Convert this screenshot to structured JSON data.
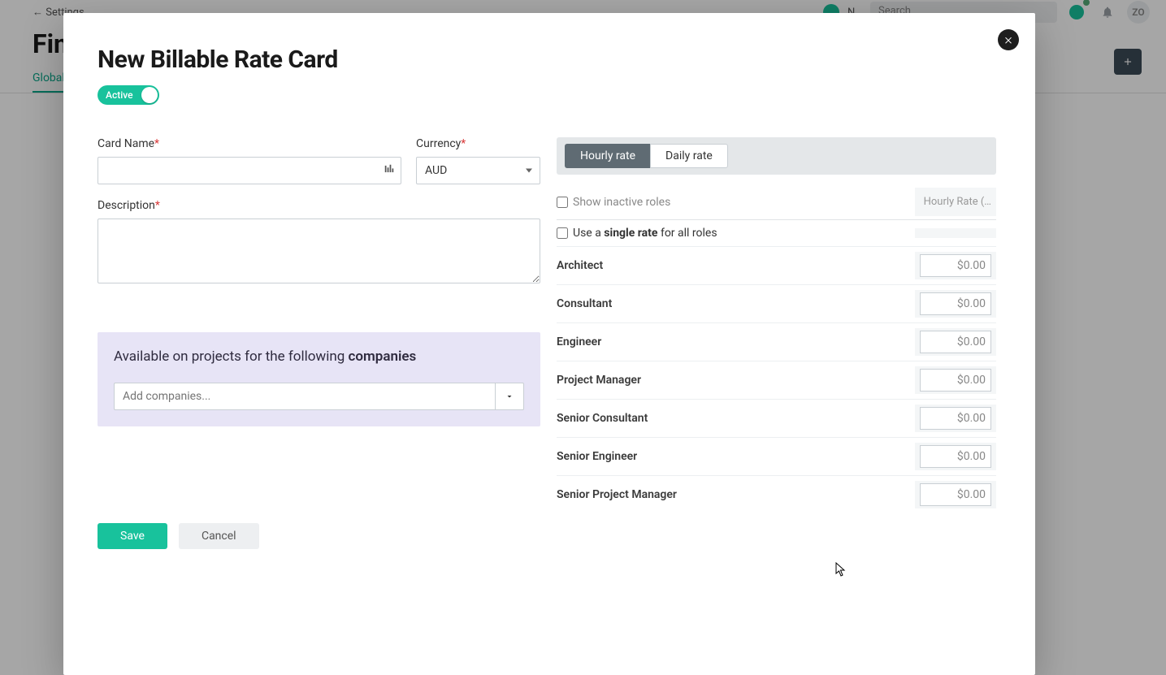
{
  "background": {
    "back_link": "← Settings",
    "page_title": "Financial",
    "tab": "Global Billable Rate Cards",
    "search_placeholder": "Search",
    "new_label": "N…",
    "avatar_initials": "ZO"
  },
  "modal": {
    "title": "New Billable Rate Card",
    "active_label": "Active",
    "labels": {
      "card_name": "Card Name",
      "currency": "Currency",
      "description": "Description"
    },
    "currency_value": "AUD",
    "companies": {
      "text_prefix": "Available on projects for the following ",
      "text_bold": "companies",
      "placeholder": "Add companies..."
    },
    "rate_toggle": {
      "hourly": "Hourly rate",
      "daily": "Daily rate"
    },
    "show_inactive": "Show inactive roles",
    "rate_column": "Hourly Rate (…",
    "single_rate_prefix": "Use a ",
    "single_rate_bold": "single rate",
    "single_rate_suffix": " for all roles",
    "roles": [
      {
        "name": "Architect",
        "rate": "$0.00"
      },
      {
        "name": "Consultant",
        "rate": "$0.00"
      },
      {
        "name": "Engineer",
        "rate": "$0.00"
      },
      {
        "name": "Project Manager",
        "rate": "$0.00"
      },
      {
        "name": "Senior Consultant",
        "rate": "$0.00"
      },
      {
        "name": "Senior Engineer",
        "rate": "$0.00"
      },
      {
        "name": "Senior Project Manager",
        "rate": "$0.00"
      }
    ],
    "buttons": {
      "save": "Save",
      "cancel": "Cancel"
    }
  }
}
